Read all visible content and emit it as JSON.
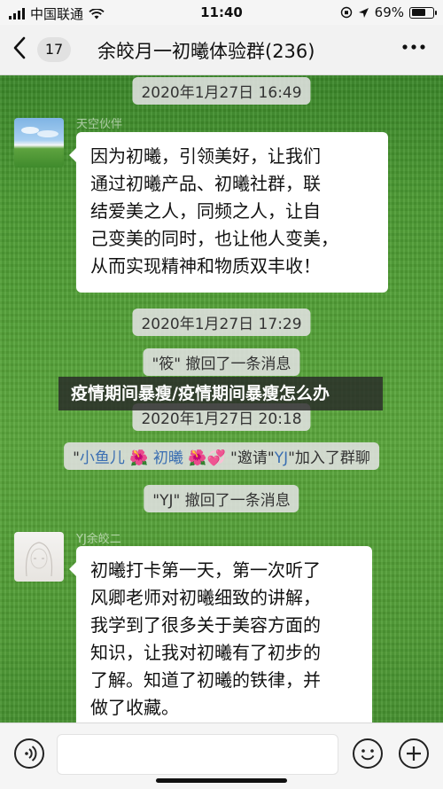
{
  "status_bar": {
    "carrier": "中国联通",
    "time": "11:40",
    "battery": "69%",
    "battery_level": 0.69
  },
  "nav": {
    "back_icon": "chevron-left-icon",
    "unread_count": "17",
    "title": "余皎月一初曦体验群(236)",
    "more_icon": "more-dots-icon"
  },
  "messages": [
    {
      "type": "time",
      "text": "2020年1月27日 16:49"
    },
    {
      "type": "bubble",
      "sender": "天空伙伴",
      "avatar": "sky-grass-avatar",
      "lines": [
        "因为初曦，引领美好，让我们",
        "通过初曦产品、初曦社群，联",
        "结爱美之人，同频之人，让自",
        "己变美的同时，也让他人变美，",
        "从而实现精神和物质双丰收！"
      ]
    },
    {
      "type": "time",
      "text": "2020年1月27日 17:29"
    },
    {
      "type": "system",
      "text": "\"筱\" 撤回了一条消息"
    },
    {
      "type": "time",
      "text": "2020年1月27日 20:18"
    },
    {
      "type": "invite",
      "before": "\"",
      "name1": "小鱼儿",
      "name2": "初曦",
      "middle": "\"邀请\"",
      "name3": "YJ",
      "after": "\"加入了群聊"
    },
    {
      "type": "system",
      "text": "\"YJ\" 撤回了一条消息"
    },
    {
      "type": "bubble",
      "sender": "YJ余皎二",
      "avatar": "girl-sketch-avatar",
      "lines": [
        "初曦打卡第一天，第一次听了",
        "风卿老师对初曦细致的讲解，",
        "我学到了很多关于美容方面的",
        "知识，让我对初曦有了初步的",
        "了解。知道了初曦的铁律，并",
        "做了收藏。"
      ]
    }
  ],
  "overlay_banner": "疫情期间暴瘦/疫情期间暴瘦怎么办",
  "bottom_bar": {
    "voice_icon": "voice-icon",
    "emoji_icon": "emoji-icon",
    "plus_icon": "plus-icon",
    "input_value": ""
  },
  "colors": {
    "link_name": "#3b6fb2",
    "grass": "#4f9b34"
  }
}
